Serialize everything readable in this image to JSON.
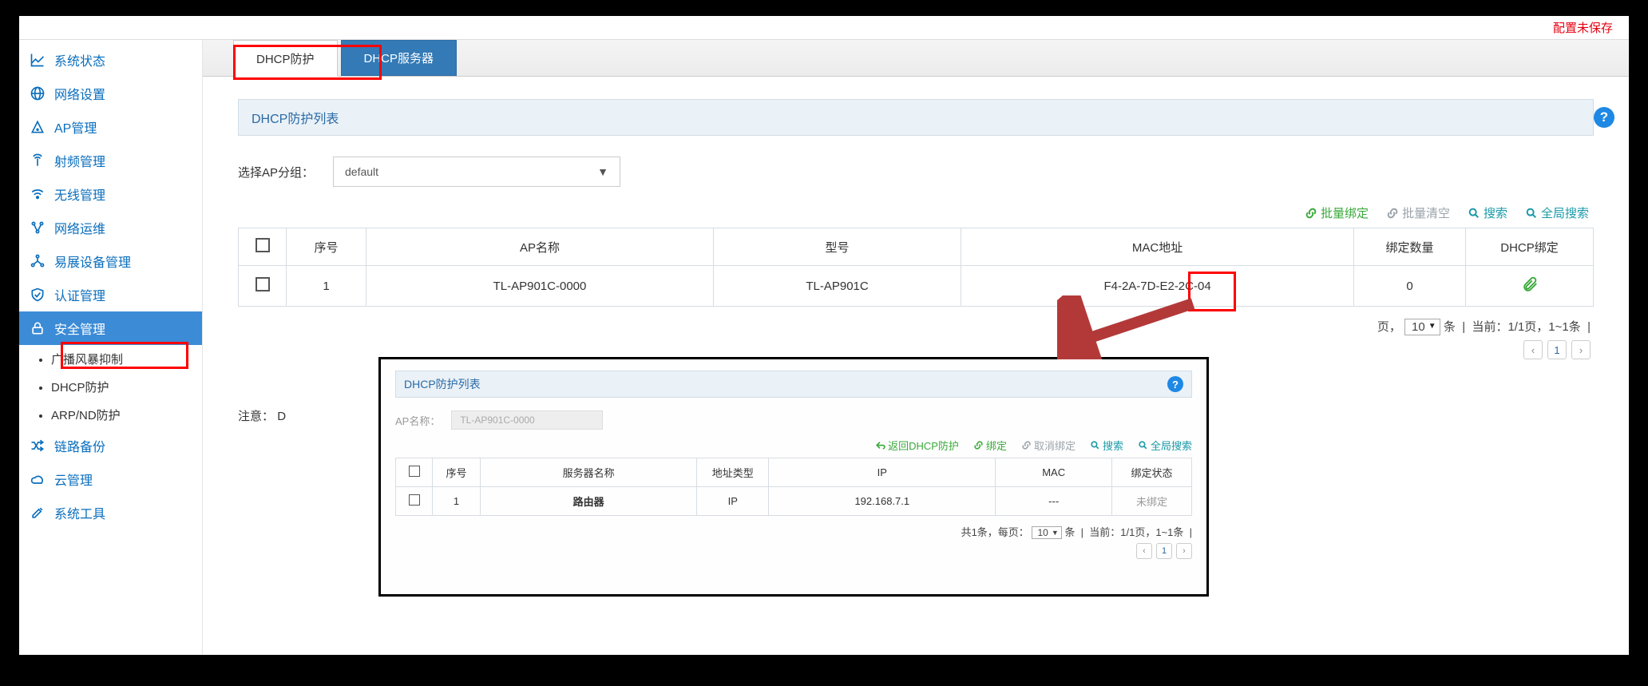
{
  "topbar": {
    "unsaved": "配置未保存"
  },
  "sidebar": {
    "items": [
      {
        "label": "系统状态"
      },
      {
        "label": "网络设置"
      },
      {
        "label": "AP管理"
      },
      {
        "label": "射频管理"
      },
      {
        "label": "无线管理"
      },
      {
        "label": "网络运维"
      },
      {
        "label": "易展设备管理"
      },
      {
        "label": "认证管理"
      },
      {
        "label": "安全管理"
      },
      {
        "label": "链路备份"
      },
      {
        "label": "云管理"
      },
      {
        "label": "系统工具"
      }
    ],
    "sub": [
      {
        "label": "广播风暴抑制"
      },
      {
        "label": "DHCP防护"
      },
      {
        "label": "ARP/ND防护"
      }
    ]
  },
  "tabs": {
    "active": "DHCP防护",
    "inactive": "DHCP服务器"
  },
  "panel": {
    "title": "DHCP防护列表",
    "select_label": "选择AP分组：",
    "select_value": "default"
  },
  "actions": {
    "bulk_bind": "批量绑定",
    "bulk_clear": "批量清空",
    "search": "搜索",
    "global_search": "全局搜索"
  },
  "table": {
    "headers": {
      "idx": "序号",
      "apname": "AP名称",
      "model": "型号",
      "mac": "MAC地址",
      "count": "绑定数量",
      "bind": "DHCP绑定"
    },
    "row": {
      "idx": "1",
      "apname": "TL-AP901C-0000",
      "model": "TL-AP901C",
      "mac": "F4-2A-7D-E2-2C-04",
      "count": "0"
    }
  },
  "pager": {
    "per_page_label_prefix": "页，",
    "sel": "10",
    "per_page_label_suffix": "条",
    "status": "当前：1/1页，1~1条",
    "num": "1"
  },
  "note": {
    "prefix": "注意：",
    "partial": "D"
  },
  "overlay": {
    "title": "DHCP防护列表",
    "apname_label": "AP名称：",
    "apname_value": "TL-AP901C-0000",
    "actions": {
      "back": "返回DHCP防护",
      "bind": "绑定",
      "unbind": "取消绑定",
      "search": "搜索",
      "global_search": "全局搜索"
    },
    "headers": {
      "idx": "序号",
      "server": "服务器名称",
      "addr_type": "地址类型",
      "ip": "IP",
      "mac": "MAC",
      "status": "绑定状态"
    },
    "row": {
      "idx": "1",
      "server": "路由器",
      "addr_type": "IP",
      "ip": "192.168.7.1",
      "mac": "---",
      "status": "未绑定"
    },
    "pager": {
      "total": "共1条，每页：",
      "sel": "10",
      "unit": "条",
      "status": "当前：1/1页，1~1条",
      "num": "1"
    }
  }
}
